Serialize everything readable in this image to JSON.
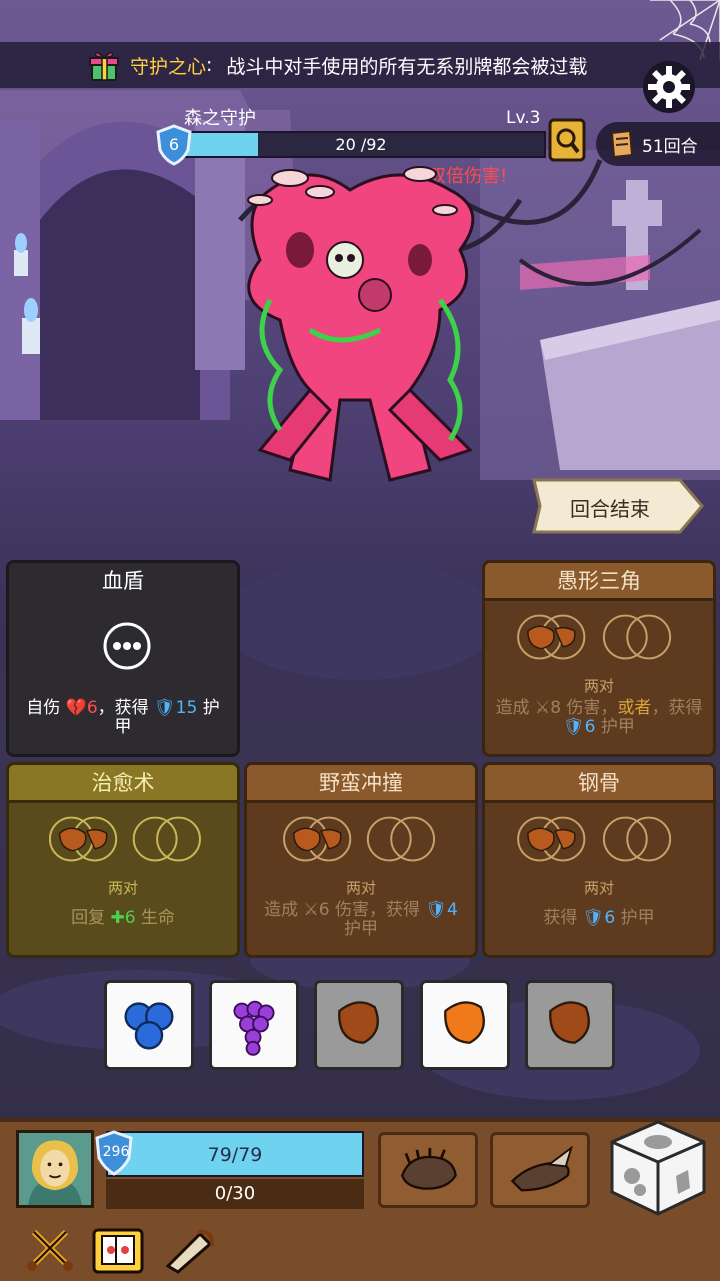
{
  "relic_banner": {
    "name": "守护之心",
    "colon": ":",
    "description": "战斗中对手使用的所有无系别牌都会被过载"
  },
  "enemy": {
    "name": "森之守护",
    "level": "Lv.3",
    "shield": "6",
    "hp_current": 20,
    "hp_max": 92,
    "hp_text": "20 /92",
    "status_text": "双倍伤害!"
  },
  "turn_counter": "51回合",
  "end_turn_label": "回合结束",
  "cards": [
    {
      "title": "血盾",
      "style": "dark",
      "desc_parts": [
        "自伤 ",
        "💔6",
        "，获得 ",
        "🛡15",
        " 护甲"
      ]
    },
    {
      "title": "愚形三角",
      "style": "brown",
      "pair_label": "两对",
      "desc_parts": [
        "造成 ",
        "⚔8",
        " 伤害，",
        "或者",
        "，获得 ",
        "🛡6",
        " 护甲"
      ]
    },
    {
      "title": "治愈术",
      "style": "olive",
      "pair_label": "两对",
      "desc_parts": [
        "回复 ",
        "✚6",
        " 生命"
      ]
    },
    {
      "title": "野蛮冲撞",
      "style": "brown",
      "pair_label": "两对",
      "desc_parts": [
        "造成 ",
        "⚔6",
        " 伤害，获得 ",
        "🛡4",
        " 护甲"
      ]
    },
    {
      "title": "钢骨",
      "style": "brown",
      "pair_label": "两对",
      "desc_parts": [
        "获得 ",
        "🛡6",
        " 护甲"
      ]
    }
  ],
  "dice": [
    {
      "face": "blueberry-icon",
      "state": "active"
    },
    {
      "face": "grape-icon",
      "state": "active"
    },
    {
      "face": "seed-icon",
      "state": "used"
    },
    {
      "face": "orange-seed-icon",
      "state": "active"
    },
    {
      "face": "seed-icon",
      "state": "used"
    }
  ],
  "player": {
    "shield": "296",
    "hp_text": "79/79",
    "armor_text": "0/30",
    "hp_fraction": 1.0
  },
  "colors": {
    "hp_bar": "#6fd3ef",
    "damage_red": "#ff4b4b",
    "armor_blue": "#4fb4ff",
    "heal_green": "#4cd14c",
    "relic_gold": "#ffd23d"
  }
}
